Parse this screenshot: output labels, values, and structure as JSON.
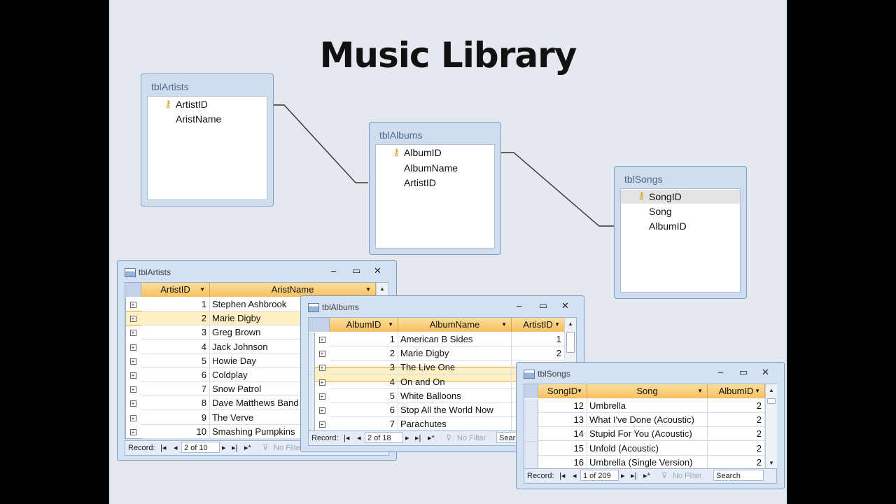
{
  "title": "Music Library",
  "relationships": {
    "artists": {
      "name": "tblArtists",
      "fields": [
        "ArtistID",
        "AristName"
      ]
    },
    "albums": {
      "name": "tblAlbums",
      "fields": [
        "AlbumID",
        "AlbumName",
        "ArtistID"
      ]
    },
    "songs": {
      "name": "tblSongs",
      "fields": [
        "SongID",
        "Song",
        "AlbumID"
      ]
    }
  },
  "icons": {
    "key": "key-icon",
    "table": "table-icon",
    "expand": "plus-expand-icon",
    "filter": "funnel-icon"
  },
  "window_controls": {
    "minimize": "–",
    "maximize": "▭",
    "close": "✕"
  },
  "nav_labels": {
    "record": "Record:",
    "no_filter": "No Filter",
    "search": "Search"
  },
  "artists_sheet": {
    "title": "tblArtists",
    "columns": [
      "ArtistID",
      "AristName"
    ],
    "rows": [
      [
        "1",
        "Stephen Ashbrook"
      ],
      [
        "2",
        "Marie Digby"
      ],
      [
        "3",
        "Greg Brown"
      ],
      [
        "4",
        "Jack Johnson"
      ],
      [
        "5",
        "Howie Day"
      ],
      [
        "6",
        "Coldplay"
      ],
      [
        "7",
        "Snow Patrol"
      ],
      [
        "8",
        "Dave Matthews Band"
      ],
      [
        "9",
        "The Verve"
      ],
      [
        "10",
        "Smashing Pumpkins"
      ]
    ],
    "selected_row": 2,
    "record": "2 of 10"
  },
  "albums_sheet": {
    "title": "tblAlbums",
    "columns": [
      "AlbumID",
      "AlbumName",
      "ArtistID"
    ],
    "rows": [
      [
        "1",
        "American B Sides",
        "1"
      ],
      [
        "2",
        "Marie Digby",
        "2"
      ],
      [
        "3",
        "The Live One",
        ""
      ],
      [
        "4",
        "On and On",
        ""
      ],
      [
        "5",
        "White Balloons",
        ""
      ],
      [
        "6",
        "Stop All the World Now",
        ""
      ],
      [
        "7",
        "Parachutes",
        ""
      ]
    ],
    "selected_row": 2,
    "record": "2 of 18",
    "search_partial": "Sear"
  },
  "songs_sheet": {
    "title": "tblSongs",
    "columns": [
      "SongID",
      "Song",
      "AlbumID"
    ],
    "rows": [
      [
        "12",
        "Umbrella",
        "2"
      ],
      [
        "13",
        "What I've Done (Acoustic)",
        "2"
      ],
      [
        "14",
        "Stupid For You (Acoustic)",
        "2"
      ],
      [
        "15",
        "Unfold (Acoustic)",
        "2"
      ],
      [
        "16",
        "Umbrella (Single Version)",
        "2"
      ]
    ],
    "record": "1 of 209"
  },
  "colors": {
    "header": "#f6c05f",
    "selected_row": "#f3a530",
    "window": "#d4e1f2",
    "slide_bg": "#e4e9ef"
  }
}
